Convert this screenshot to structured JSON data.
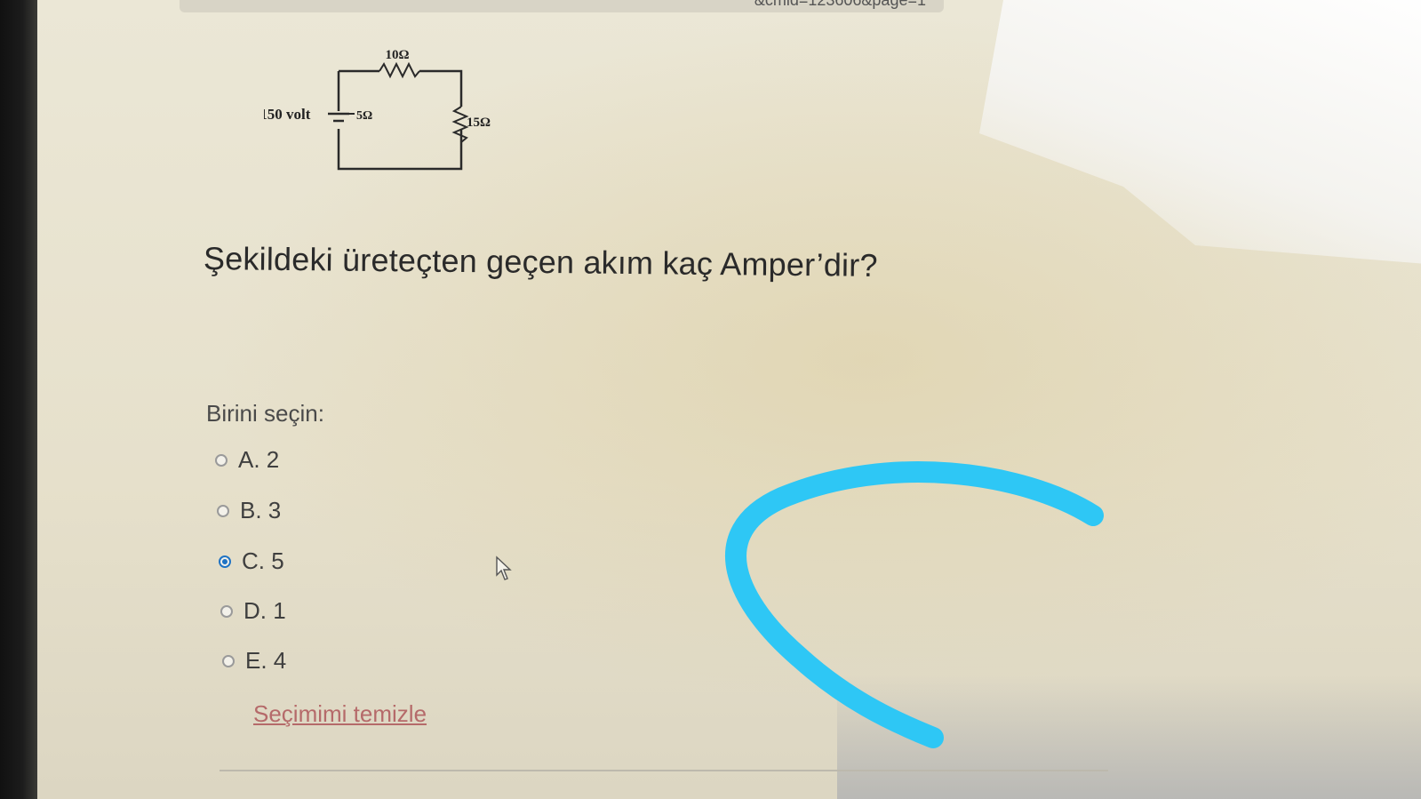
{
  "browser": {
    "url_fragment": "&cmid=123606&page=1"
  },
  "circuit": {
    "top_resistor": "10Ω",
    "left_resistor": "5Ω",
    "right_resistor": "15Ω",
    "source": "E= 150 volt"
  },
  "question": {
    "text": "Şekildeki üreteçten geçen akım kaç Amper’dir?",
    "prompt": "Birini seçin:",
    "options": [
      {
        "label": "A. 2",
        "selected": false
      },
      {
        "label": "B. 3",
        "selected": false
      },
      {
        "label": "C. 5",
        "selected": true
      },
      {
        "label": "D. 1",
        "selected": false
      },
      {
        "label": "E. 4",
        "selected": false
      }
    ],
    "clear_label": "Seçimimi temizle"
  },
  "colors": {
    "accent": "#1f73c4",
    "annotation_stroke": "#2ec7f5",
    "link": "#b56a6a"
  }
}
